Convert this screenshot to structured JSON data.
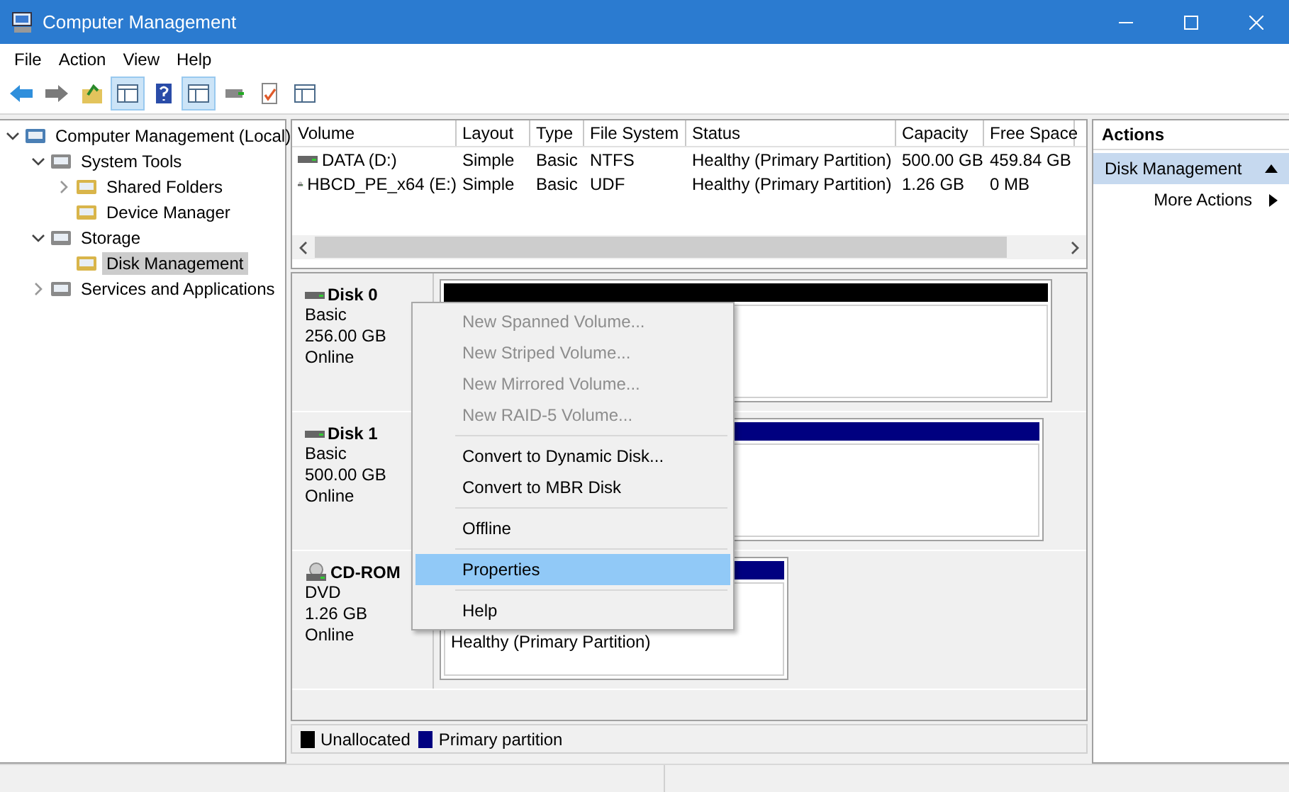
{
  "window": {
    "title": "Computer Management"
  },
  "menu_bar": [
    "File",
    "Action",
    "View",
    "Help"
  ],
  "toolbar": [
    {
      "kind": "back",
      "pressed": false
    },
    {
      "kind": "forward",
      "pressed": false
    },
    {
      "kind": "up",
      "pressed": false
    },
    {
      "kind": "tree",
      "pressed": true
    },
    {
      "kind": "help",
      "pressed": false
    },
    {
      "kind": "pane",
      "pressed": true
    },
    {
      "kind": "connect",
      "pressed": false
    },
    {
      "kind": "properties",
      "pressed": false
    },
    {
      "kind": "list",
      "pressed": false
    }
  ],
  "tree": [
    {
      "label": "Computer Management (Local)",
      "selected": false,
      "expanded": true,
      "children": [
        {
          "label": "System Tools",
          "selected": false,
          "expanded": true,
          "children": [
            {
              "label": "Shared Folders",
              "selected": false,
              "expanded": false
            },
            {
              "label": "Device Manager",
              "selected": false
            }
          ]
        },
        {
          "label": "Storage",
          "selected": false,
          "expanded": true,
          "children": [
            {
              "label": "Disk Management",
              "selected": true
            }
          ]
        },
        {
          "label": "Services and Applications",
          "selected": false,
          "expanded": false
        }
      ]
    }
  ],
  "volume_table": {
    "columns": [
      "Volume",
      "Layout",
      "Type",
      "File System",
      "Status",
      "Capacity",
      "Free Space"
    ],
    "rows": [
      {
        "kind": "hdd",
        "cells": [
          "DATA (D:)",
          "Simple",
          "Basic",
          "NTFS",
          "Healthy (Primary Partition)",
          "500.00 GB",
          "459.84 GB"
        ]
      },
      {
        "kind": "cd",
        "cells": [
          "HBCD_PE_x64 (E:)",
          "Simple",
          "Basic",
          "UDF",
          "Healthy (Primary Partition)",
          "1.26 GB",
          "0 MB"
        ]
      }
    ]
  },
  "disks": [
    {
      "kind": "disk",
      "name": "Disk 0",
      "type": "Basic",
      "size": "256.00 GB",
      "state": "Online",
      "partition": {
        "kind": "unallocated"
      }
    },
    {
      "kind": "disk",
      "name": "Disk 1",
      "type": "Basic",
      "size": "500.00 GB",
      "state": "Online",
      "partition": {
        "kind": "primary"
      }
    },
    {
      "kind": "cdrom",
      "name": "CD-ROM",
      "type": "DVD",
      "size": "1.26 GB",
      "state": "Online",
      "partition": {
        "kind": "primary",
        "lines": [
          "Healthy (Primary Partition)"
        ]
      }
    }
  ],
  "legend": [
    {
      "label": "Unallocated",
      "color": "#000000"
    },
    {
      "label": "Primary partition",
      "color": "#000080"
    }
  ],
  "context_menu": [
    [
      {
        "label": "New Spanned Volume...",
        "disabled": true,
        "selected": false
      },
      {
        "label": "New Striped Volume...",
        "disabled": true,
        "selected": false
      },
      {
        "label": "New Mirrored Volume...",
        "disabled": true,
        "selected": false
      },
      {
        "label": "New RAID-5 Volume...",
        "disabled": true,
        "selected": false
      }
    ],
    [
      {
        "label": "Convert to Dynamic Disk...",
        "disabled": false,
        "selected": false
      },
      {
        "label": "Convert to MBR Disk",
        "disabled": false,
        "selected": false
      }
    ],
    [
      {
        "label": "Offline",
        "disabled": false,
        "selected": false
      }
    ],
    [
      {
        "label": "Properties",
        "disabled": false,
        "selected": true
      }
    ],
    [
      {
        "label": "Help",
        "disabled": false,
        "selected": false
      }
    ]
  ],
  "actions": {
    "title": "Actions",
    "section": {
      "label": "Disk Management",
      "expanded": true
    },
    "items": [
      "More Actions"
    ]
  }
}
